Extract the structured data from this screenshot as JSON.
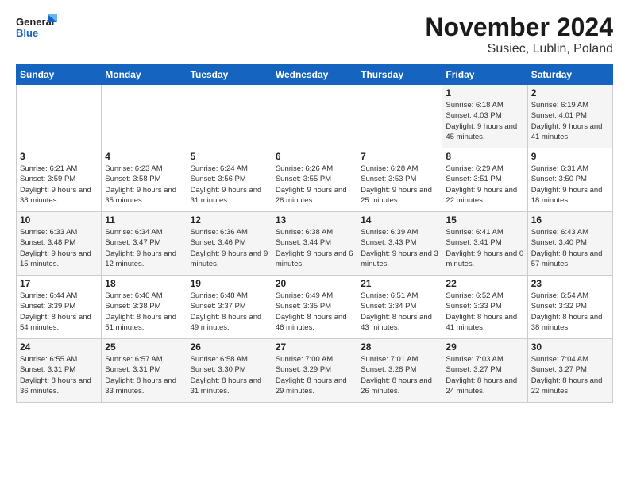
{
  "logo": {
    "line1": "General",
    "line2": "Blue"
  },
  "title": "November 2024",
  "location": "Susiec, Lublin, Poland",
  "header_days": [
    "Sunday",
    "Monday",
    "Tuesday",
    "Wednesday",
    "Thursday",
    "Friday",
    "Saturday"
  ],
  "weeks": [
    [
      {
        "day": "",
        "info": ""
      },
      {
        "day": "",
        "info": ""
      },
      {
        "day": "",
        "info": ""
      },
      {
        "day": "",
        "info": ""
      },
      {
        "day": "",
        "info": ""
      },
      {
        "day": "1",
        "info": "Sunrise: 6:18 AM\nSunset: 4:03 PM\nDaylight: 9 hours and 45 minutes."
      },
      {
        "day": "2",
        "info": "Sunrise: 6:19 AM\nSunset: 4:01 PM\nDaylight: 9 hours and 41 minutes."
      }
    ],
    [
      {
        "day": "3",
        "info": "Sunrise: 6:21 AM\nSunset: 3:59 PM\nDaylight: 9 hours and 38 minutes."
      },
      {
        "day": "4",
        "info": "Sunrise: 6:23 AM\nSunset: 3:58 PM\nDaylight: 9 hours and 35 minutes."
      },
      {
        "day": "5",
        "info": "Sunrise: 6:24 AM\nSunset: 3:56 PM\nDaylight: 9 hours and 31 minutes."
      },
      {
        "day": "6",
        "info": "Sunrise: 6:26 AM\nSunset: 3:55 PM\nDaylight: 9 hours and 28 minutes."
      },
      {
        "day": "7",
        "info": "Sunrise: 6:28 AM\nSunset: 3:53 PM\nDaylight: 9 hours and 25 minutes."
      },
      {
        "day": "8",
        "info": "Sunrise: 6:29 AM\nSunset: 3:51 PM\nDaylight: 9 hours and 22 minutes."
      },
      {
        "day": "9",
        "info": "Sunrise: 6:31 AM\nSunset: 3:50 PM\nDaylight: 9 hours and 18 minutes."
      }
    ],
    [
      {
        "day": "10",
        "info": "Sunrise: 6:33 AM\nSunset: 3:48 PM\nDaylight: 9 hours and 15 minutes."
      },
      {
        "day": "11",
        "info": "Sunrise: 6:34 AM\nSunset: 3:47 PM\nDaylight: 9 hours and 12 minutes."
      },
      {
        "day": "12",
        "info": "Sunrise: 6:36 AM\nSunset: 3:46 PM\nDaylight: 9 hours and 9 minutes."
      },
      {
        "day": "13",
        "info": "Sunrise: 6:38 AM\nSunset: 3:44 PM\nDaylight: 9 hours and 6 minutes."
      },
      {
        "day": "14",
        "info": "Sunrise: 6:39 AM\nSunset: 3:43 PM\nDaylight: 9 hours and 3 minutes."
      },
      {
        "day": "15",
        "info": "Sunrise: 6:41 AM\nSunset: 3:41 PM\nDaylight: 9 hours and 0 minutes."
      },
      {
        "day": "16",
        "info": "Sunrise: 6:43 AM\nSunset: 3:40 PM\nDaylight: 8 hours and 57 minutes."
      }
    ],
    [
      {
        "day": "17",
        "info": "Sunrise: 6:44 AM\nSunset: 3:39 PM\nDaylight: 8 hours and 54 minutes."
      },
      {
        "day": "18",
        "info": "Sunrise: 6:46 AM\nSunset: 3:38 PM\nDaylight: 8 hours and 51 minutes."
      },
      {
        "day": "19",
        "info": "Sunrise: 6:48 AM\nSunset: 3:37 PM\nDaylight: 8 hours and 49 minutes."
      },
      {
        "day": "20",
        "info": "Sunrise: 6:49 AM\nSunset: 3:35 PM\nDaylight: 8 hours and 46 minutes."
      },
      {
        "day": "21",
        "info": "Sunrise: 6:51 AM\nSunset: 3:34 PM\nDaylight: 8 hours and 43 minutes."
      },
      {
        "day": "22",
        "info": "Sunrise: 6:52 AM\nSunset: 3:33 PM\nDaylight: 8 hours and 41 minutes."
      },
      {
        "day": "23",
        "info": "Sunrise: 6:54 AM\nSunset: 3:32 PM\nDaylight: 8 hours and 38 minutes."
      }
    ],
    [
      {
        "day": "24",
        "info": "Sunrise: 6:55 AM\nSunset: 3:31 PM\nDaylight: 8 hours and 36 minutes."
      },
      {
        "day": "25",
        "info": "Sunrise: 6:57 AM\nSunset: 3:31 PM\nDaylight: 8 hours and 33 minutes."
      },
      {
        "day": "26",
        "info": "Sunrise: 6:58 AM\nSunset: 3:30 PM\nDaylight: 8 hours and 31 minutes."
      },
      {
        "day": "27",
        "info": "Sunrise: 7:00 AM\nSunset: 3:29 PM\nDaylight: 8 hours and 29 minutes."
      },
      {
        "day": "28",
        "info": "Sunrise: 7:01 AM\nSunset: 3:28 PM\nDaylight: 8 hours and 26 minutes."
      },
      {
        "day": "29",
        "info": "Sunrise: 7:03 AM\nSunset: 3:27 PM\nDaylight: 8 hours and 24 minutes."
      },
      {
        "day": "30",
        "info": "Sunrise: 7:04 AM\nSunset: 3:27 PM\nDaylight: 8 hours and 22 minutes."
      }
    ]
  ]
}
